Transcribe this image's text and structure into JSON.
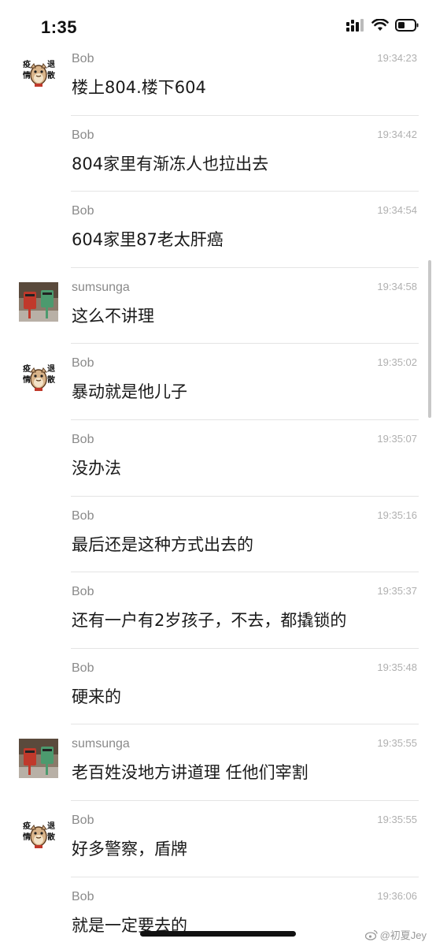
{
  "status_bar": {
    "time": "1:35"
  },
  "messages": [
    {
      "sender": "Bob",
      "time": "19:34:23",
      "text": "楼上804.楼下604",
      "avatar": "bob"
    },
    {
      "sender": "Bob",
      "time": "19:34:42",
      "text": "804家里有渐冻人也拉出去",
      "avatar": ""
    },
    {
      "sender": "Bob",
      "time": "19:34:54",
      "text": "604家里87老太肝癌",
      "avatar": ""
    },
    {
      "sender": "sumsunga",
      "time": "19:34:58",
      "text": "这么不讲理",
      "avatar": "sumsunga"
    },
    {
      "sender": "Bob",
      "time": "19:35:02",
      "text": "暴动就是他儿子",
      "avatar": "bob"
    },
    {
      "sender": "Bob",
      "time": "19:35:07",
      "text": "没办法",
      "avatar": ""
    },
    {
      "sender": "Bob",
      "time": "19:35:16",
      "text": "最后还是这种方式出去的",
      "avatar": ""
    },
    {
      "sender": "Bob",
      "time": "19:35:37",
      "text": "还有一户有2岁孩子，不去，都撬锁的",
      "avatar": ""
    },
    {
      "sender": "Bob",
      "time": "19:35:48",
      "text": "硬来的",
      "avatar": ""
    },
    {
      "sender": "sumsunga",
      "time": "19:35:55",
      "text": "老百姓没地方讲道理 任他们宰割",
      "avatar": "sumsunga"
    },
    {
      "sender": "Bob",
      "time": "19:35:55",
      "text": "好多警察，盾牌",
      "avatar": "bob"
    },
    {
      "sender": "Bob",
      "time": "19:36:06",
      "text": "就是一定要去的",
      "avatar": ""
    }
  ],
  "avatar_text": {
    "bob": [
      "疫",
      "情",
      "退",
      "散"
    ]
  },
  "watermark": {
    "text": "@初夏Jey"
  },
  "colors": {
    "sender": "#8a8a8a",
    "timestamp": "#b0b0b0",
    "message_text": "#1a1a1a",
    "divider": "#e4e4e4",
    "bob_avatar_accent": "#c0392b",
    "sumsunga_avatar_red": "#c0392b",
    "sumsunga_avatar_green": "#4c9a6e"
  }
}
